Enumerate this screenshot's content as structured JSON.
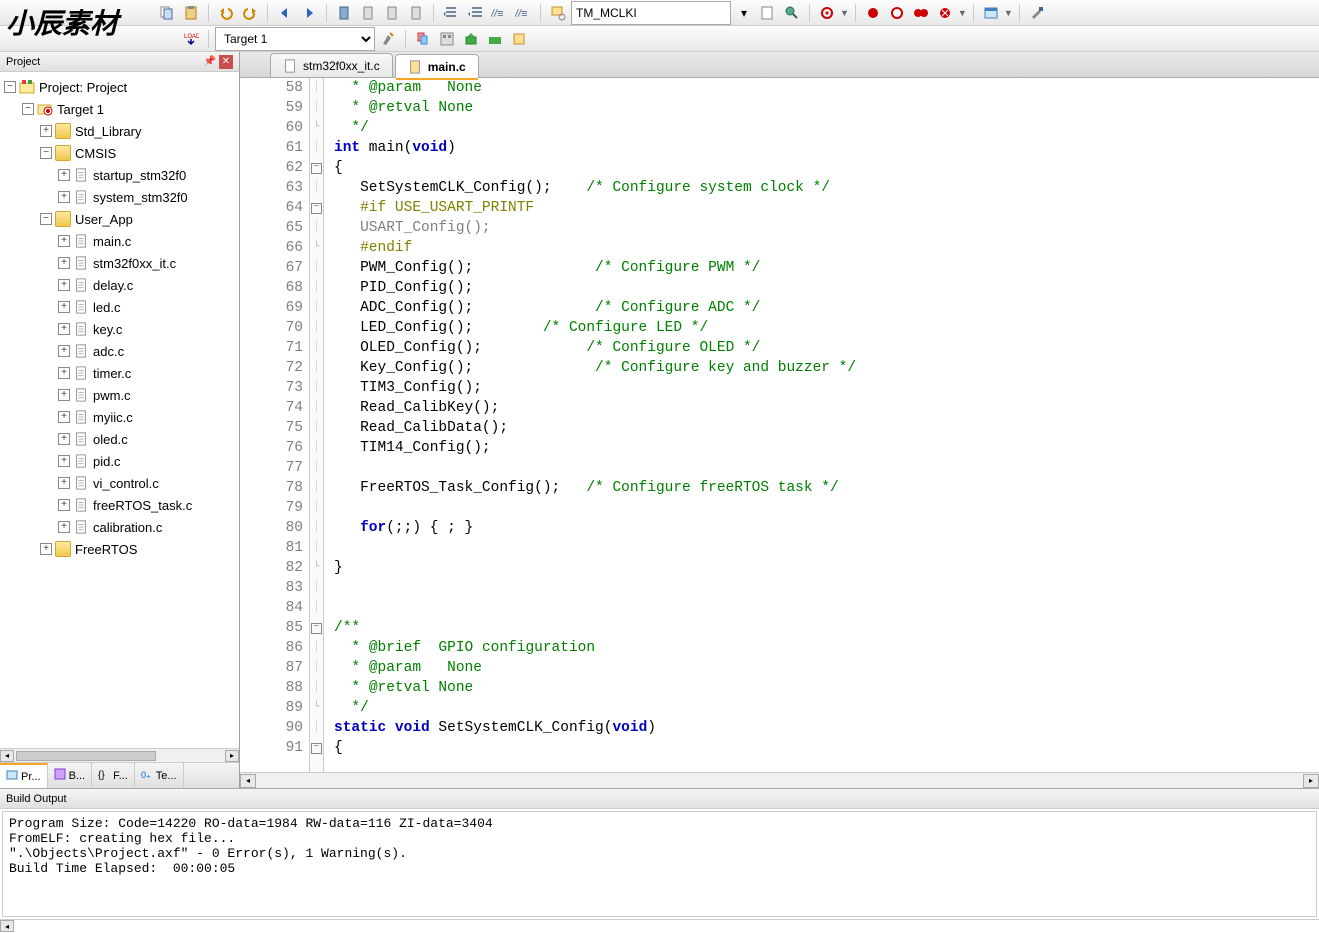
{
  "watermark": "小辰素材",
  "toolbar": {
    "find_value": "TM_MCLKI",
    "target_label": "Target 1"
  },
  "project": {
    "panel_title": "Project",
    "root": "Project: Project",
    "target": "Target 1",
    "groups": [
      {
        "name": "Std_Library",
        "files": []
      },
      {
        "name": "CMSIS",
        "open": true,
        "files": [
          "startup_stm32f0",
          "system_stm32f0"
        ]
      },
      {
        "name": "User_App",
        "open": true,
        "files": [
          "main.c",
          "stm32f0xx_it.c",
          "delay.c",
          "led.c",
          "key.c",
          "adc.c",
          "timer.c",
          "pwm.c",
          "myiic.c",
          "oled.c",
          "pid.c",
          "vi_control.c",
          "freeRTOS_task.c",
          "calibration.c"
        ]
      },
      {
        "name": "FreeRTOS",
        "files": []
      }
    ],
    "bottom_tabs": [
      "Pr...",
      "B...",
      "F...",
      "Te..."
    ]
  },
  "editor": {
    "tabs": [
      {
        "name": "stm32f0xx_it.c",
        "active": false
      },
      {
        "name": "main.c",
        "active": true
      }
    ],
    "first_line": 58,
    "lines": [
      {
        "n": 58,
        "f": "",
        "tok": [
          [
            "  * ",
            "cmt"
          ],
          [
            "@param",
            "cmt"
          ],
          [
            "   None",
            "cmt"
          ]
        ]
      },
      {
        "n": 59,
        "f": "",
        "tok": [
          [
            "  * ",
            "cmt"
          ],
          [
            "@retval",
            "cmt"
          ],
          [
            " None",
            "cmt"
          ]
        ]
      },
      {
        "n": 60,
        "f": "e",
        "tok": [
          [
            "  */",
            "cmt"
          ]
        ]
      },
      {
        "n": 61,
        "f": "",
        "tok": [
          [
            "int",
            "kw"
          ],
          [
            " main(",
            ""
          ],
          [
            "void",
            "kw"
          ],
          [
            ")",
            ""
          ]
        ]
      },
      {
        "n": 62,
        "f": "-",
        "tok": [
          [
            "{",
            ""
          ]
        ]
      },
      {
        "n": 63,
        "f": "",
        "tok": [
          [
            "   SetSystemCLK_Config();    ",
            ""
          ],
          [
            "/* Configure system clock */",
            "cmt"
          ]
        ]
      },
      {
        "n": 64,
        "f": "-",
        "tok": [
          [
            "   ",
            ""
          ],
          [
            "#if USE_USART_PRINTF",
            "pp"
          ]
        ]
      },
      {
        "n": 65,
        "f": "",
        "tok": [
          [
            "   USART_Config();",
            "dim"
          ]
        ]
      },
      {
        "n": 66,
        "f": "e",
        "tok": [
          [
            "   ",
            ""
          ],
          [
            "#endif",
            "pp"
          ]
        ]
      },
      {
        "n": 67,
        "f": "",
        "tok": [
          [
            "   PWM_Config();              ",
            ""
          ],
          [
            "/* Configure PWM */",
            "cmt"
          ]
        ]
      },
      {
        "n": 68,
        "f": "",
        "tok": [
          [
            "   PID_Config();",
            ""
          ]
        ]
      },
      {
        "n": 69,
        "f": "",
        "tok": [
          [
            "   ADC_Config();              ",
            ""
          ],
          [
            "/* Configure ADC */",
            "cmt"
          ]
        ]
      },
      {
        "n": 70,
        "f": "",
        "tok": [
          [
            "   LED_Config();        ",
            ""
          ],
          [
            "/* Configure LED */",
            "cmt"
          ]
        ]
      },
      {
        "n": 71,
        "f": "",
        "tok": [
          [
            "   OLED_Config();            ",
            ""
          ],
          [
            "/* Configure OLED */",
            "cmt"
          ]
        ]
      },
      {
        "n": 72,
        "f": "",
        "tok": [
          [
            "   Key_Config();              ",
            ""
          ],
          [
            "/* Configure key and buzzer */",
            "cmt"
          ]
        ]
      },
      {
        "n": 73,
        "f": "",
        "tok": [
          [
            "   TIM3_Config();",
            ""
          ]
        ]
      },
      {
        "n": 74,
        "f": "",
        "tok": [
          [
            "   Read_CalibKey();",
            ""
          ]
        ]
      },
      {
        "n": 75,
        "f": "",
        "tok": [
          [
            "   Read_CalibData();",
            ""
          ]
        ]
      },
      {
        "n": 76,
        "f": "",
        "tok": [
          [
            "   TIM14_Config();",
            ""
          ]
        ]
      },
      {
        "n": 77,
        "f": "",
        "tok": [
          [
            "",
            ""
          ]
        ]
      },
      {
        "n": 78,
        "f": "",
        "tok": [
          [
            "   FreeRTOS_Task_Config();   ",
            ""
          ],
          [
            "/* Configure freeRTOS task */",
            "cmt"
          ]
        ]
      },
      {
        "n": 79,
        "f": "",
        "tok": [
          [
            "",
            ""
          ]
        ]
      },
      {
        "n": 80,
        "f": "",
        "tok": [
          [
            "   ",
            ""
          ],
          [
            "for",
            "kw"
          ],
          [
            "(;;) { ; }",
            ""
          ]
        ]
      },
      {
        "n": 81,
        "f": "",
        "tok": [
          [
            "",
            ""
          ]
        ]
      },
      {
        "n": 82,
        "f": "e",
        "tok": [
          [
            "}",
            ""
          ]
        ]
      },
      {
        "n": 83,
        "f": "",
        "tok": [
          [
            "",
            ""
          ]
        ]
      },
      {
        "n": 84,
        "f": "",
        "tok": [
          [
            "",
            ""
          ]
        ]
      },
      {
        "n": 85,
        "f": "-",
        "tok": [
          [
            "/**",
            "cmt"
          ]
        ]
      },
      {
        "n": 86,
        "f": "",
        "tok": [
          [
            "  * ",
            "cmt"
          ],
          [
            "@brief",
            "cmt"
          ],
          [
            "  GPIO configuration",
            "cmt"
          ]
        ]
      },
      {
        "n": 87,
        "f": "",
        "tok": [
          [
            "  * ",
            "cmt"
          ],
          [
            "@param",
            "cmt"
          ],
          [
            "   None",
            "cmt"
          ]
        ]
      },
      {
        "n": 88,
        "f": "",
        "tok": [
          [
            "  * ",
            "cmt"
          ],
          [
            "@retval",
            "cmt"
          ],
          [
            " None",
            "cmt"
          ]
        ]
      },
      {
        "n": 89,
        "f": "e",
        "tok": [
          [
            "  */",
            "cmt"
          ]
        ]
      },
      {
        "n": 90,
        "f": "",
        "tok": [
          [
            "static",
            "kw"
          ],
          [
            " ",
            ""
          ],
          [
            "void",
            "kw"
          ],
          [
            " SetSystemCLK_Config(",
            ""
          ],
          [
            "void",
            "kw"
          ],
          [
            ")",
            ""
          ]
        ]
      },
      {
        "n": 91,
        "f": "-",
        "tok": [
          [
            "{",
            ""
          ]
        ]
      }
    ]
  },
  "build": {
    "title": "Build Output",
    "lines": [
      "Program Size: Code=14220 RO-data=1984 RW-data=116 ZI-data=3404",
      "FromELF: creating hex file...",
      "\".\\Objects\\Project.axf\" - 0 Error(s), 1 Warning(s).",
      "Build Time Elapsed:  00:00:05"
    ]
  }
}
